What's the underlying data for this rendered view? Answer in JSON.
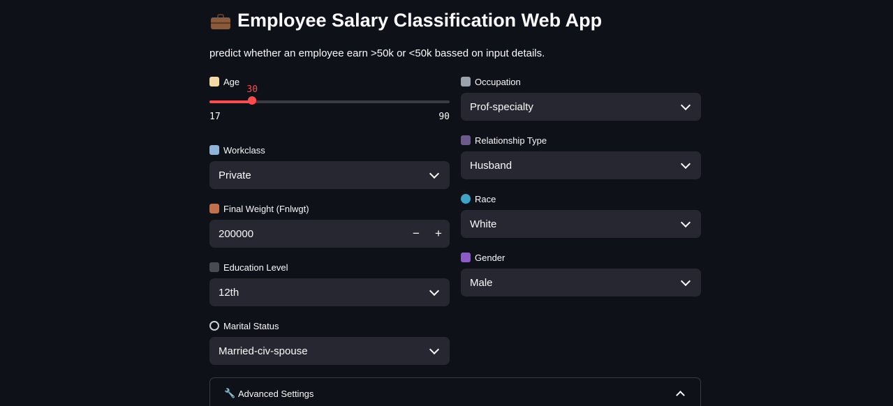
{
  "header": {
    "title": "Employee Salary Classification Web App",
    "title_icon": "briefcase-icon",
    "subtitle": "predict whether an employee earn >50k or <50k bassed on input details."
  },
  "age": {
    "label": "Age",
    "icon": "birthday-cake-icon",
    "value": "30",
    "min": "17",
    "max": "90",
    "fraction": 0.178
  },
  "workclass": {
    "label": "Workclass",
    "icon": "office-building-icon",
    "value": "Private"
  },
  "fnlwgt": {
    "label": "Final Weight (Fnlwgt)",
    "icon": "abacus-icon",
    "value": "200000",
    "minus": "−",
    "plus": "+"
  },
  "education": {
    "label": "Education Level",
    "icon": "graduation-cap-icon",
    "value": "12th"
  },
  "marital": {
    "label": "Marital Status",
    "icon": "ring-icon",
    "value": "Married-civ-spouse"
  },
  "occupation": {
    "label": "Occupation",
    "icon": "tools-icon",
    "value": "Prof-specialty"
  },
  "relationship": {
    "label": "Relationship Type",
    "icon": "people-icon",
    "value": "Husband"
  },
  "race": {
    "label": "Race",
    "icon": "globe-icon",
    "value": "White"
  },
  "gender": {
    "label": "Gender",
    "icon": "gender-symbol-icon",
    "value": "Male"
  },
  "advanced": {
    "label": "Advanced Settings",
    "icon": "wrench-icon"
  },
  "colors": {
    "accent": "#ff4b4b",
    "background": "#0e1117",
    "input_bg": "#262730"
  }
}
